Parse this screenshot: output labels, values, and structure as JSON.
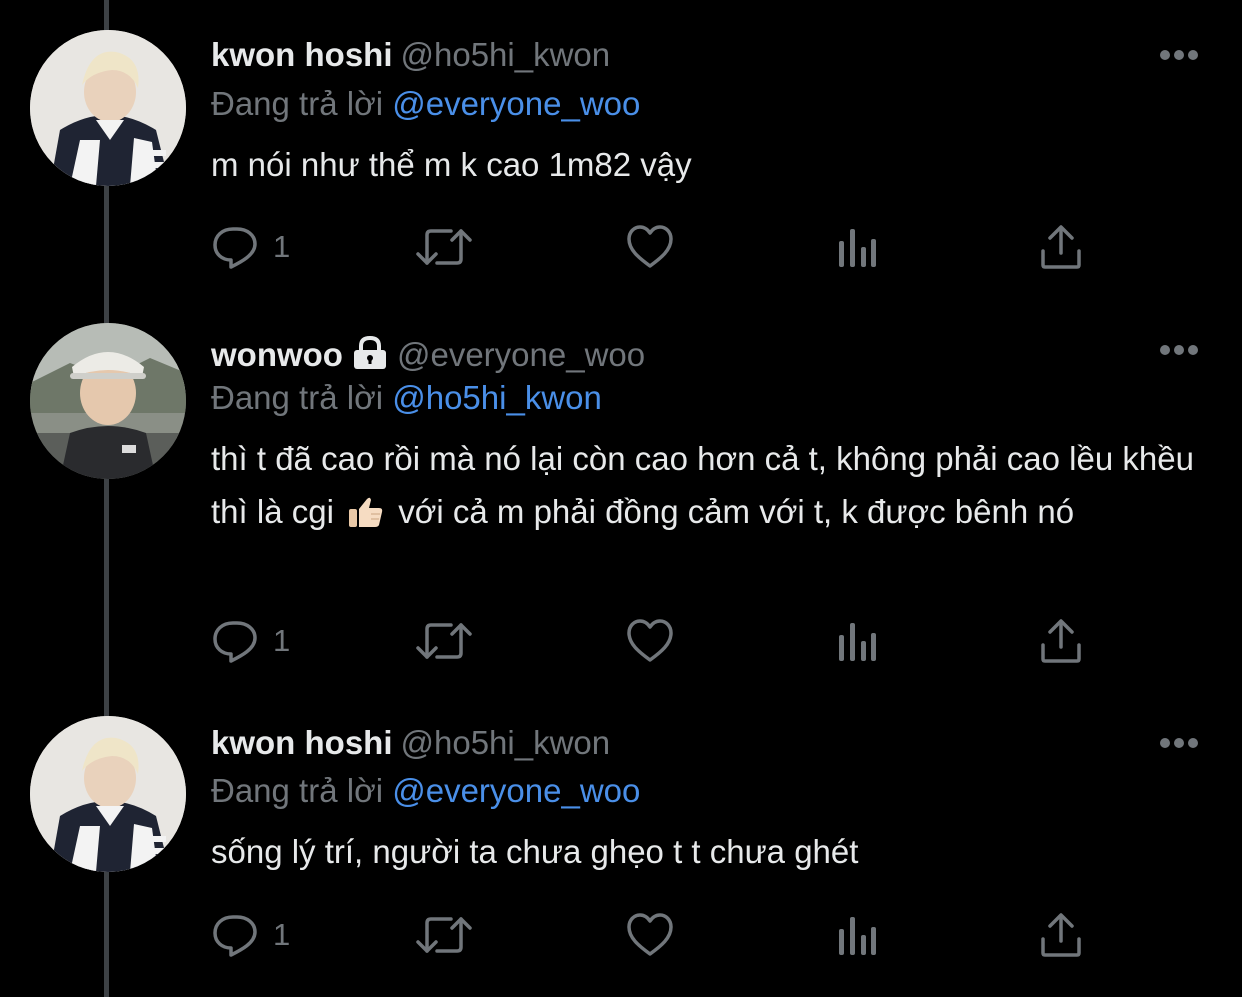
{
  "tweets": [
    {
      "name": "kwon hoshi",
      "handle": "@ho5hi_kwon",
      "locked": false,
      "reply_prefix": "Đang trả lời",
      "reply_to": "@everyone_woo",
      "text": "m nói như thể m k cao 1m82 vậy",
      "reply_count": "1"
    },
    {
      "name": "wonwoo",
      "handle": "@everyone_woo",
      "locked": true,
      "reply_prefix": "Đang trả lời",
      "reply_to": "@ho5hi_kwon",
      "text_before_emoji": "thì t đã cao rồi mà nó lại còn cao hơn cả t, không phải cao lều khều thì là cgi",
      "emoji": "thumbs-up",
      "text_after_emoji": "với cả m phải đồng cảm với t, k được bênh nó",
      "reply_count": "1"
    },
    {
      "name": "kwon hoshi",
      "handle": "@ho5hi_kwon",
      "locked": false,
      "reply_prefix": "Đang trả lời",
      "reply_to": "@everyone_woo",
      "text": "sống lý trí, người ta chưa ghẹo t t chưa ghét",
      "reply_count": "1"
    }
  ],
  "colors": {
    "background": "#000000",
    "text": "#e7e9ea",
    "secondary": "#71767b",
    "mention": "#4a8fe8",
    "thread_line": "#3d4145"
  },
  "icons": [
    "reply-icon",
    "retweet-icon",
    "like-icon",
    "analytics-icon",
    "share-icon",
    "more-icon",
    "lock-icon"
  ]
}
